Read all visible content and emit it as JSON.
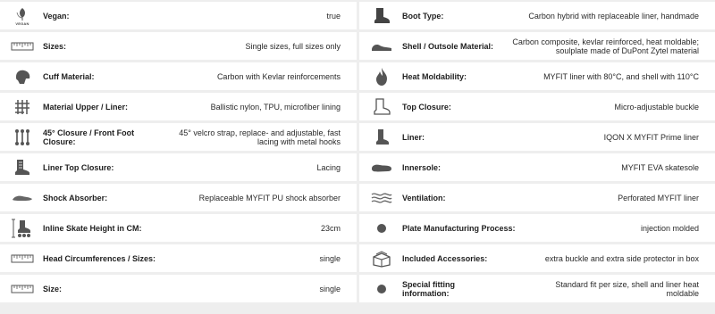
{
  "specs_left": [
    {
      "icon": "vegan-leaf-icon",
      "label": "Vegan:",
      "value": "true",
      "icon_text": "VEGAN"
    },
    {
      "icon": "ruler-icon",
      "label": "Sizes:",
      "value": "Single sizes, full sizes only"
    },
    {
      "icon": "helmet-cuff-icon",
      "label": "Cuff Material:",
      "value": "Carbon with Kevlar reinforcements"
    },
    {
      "icon": "fabric-grid-icon",
      "label": "Material Upper / Liner:",
      "value": "Ballistic nylon, TPU, microfiber lining"
    },
    {
      "icon": "straps-icon",
      "label": "45° Closure / Front Foot Closure:",
      "value": "45° velcro strap, replace- and adjustable, fast lacing with metal hooks"
    },
    {
      "icon": "liner-lacing-icon",
      "label": "Liner Top Closure:",
      "value": "Lacing"
    },
    {
      "icon": "shock-absorber-icon",
      "label": "Shock Absorber:",
      "value": "Replaceable MYFIT PU shock absorber"
    },
    {
      "icon": "inline-skate-height-icon",
      "label": "Inline Skate Height in CM:",
      "value": "23cm"
    },
    {
      "icon": "ruler-icon",
      "label": "Head Circumferences / Sizes:",
      "value": "single"
    },
    {
      "icon": "ruler-icon",
      "label": "Size:",
      "value": "single"
    }
  ],
  "specs_right": [
    {
      "icon": "boot-icon",
      "label": "Boot Type:",
      "value": "Carbon hybrid with replaceable liner, handmade"
    },
    {
      "icon": "shoe-shell-icon",
      "label": "Shell / Outsole Material:",
      "value": "Carbon composite, kevlar reinforced, heat moldable; soulplate made of DuPont Zytel material"
    },
    {
      "icon": "flame-icon",
      "label": "Heat Moldability:",
      "value": "MYFIT liner with 80°C, and shell with 110°C"
    },
    {
      "icon": "boot-outline-icon",
      "label": "Top Closure:",
      "value": "Micro-adjustable buckle"
    },
    {
      "icon": "liner-icon",
      "label": "Liner:",
      "value": "IQON X MYFIT Prime liner"
    },
    {
      "icon": "insole-icon",
      "label": "Innersole:",
      "value": "MYFIT EVA skatesole"
    },
    {
      "icon": "ventilation-waves-icon",
      "label": "Ventilation:",
      "value": "Perforated MYFIT liner"
    },
    {
      "icon": "dot-icon",
      "label": "Plate Manufacturing Process:",
      "value": "injection molded"
    },
    {
      "icon": "box-icon",
      "label": "Included Accessories:",
      "value": "extra buckle and extra side protector in box"
    },
    {
      "icon": "dot-icon",
      "label": "Special fitting information:",
      "value": "Standard fit per size, shell and liner heat moldable"
    }
  ]
}
